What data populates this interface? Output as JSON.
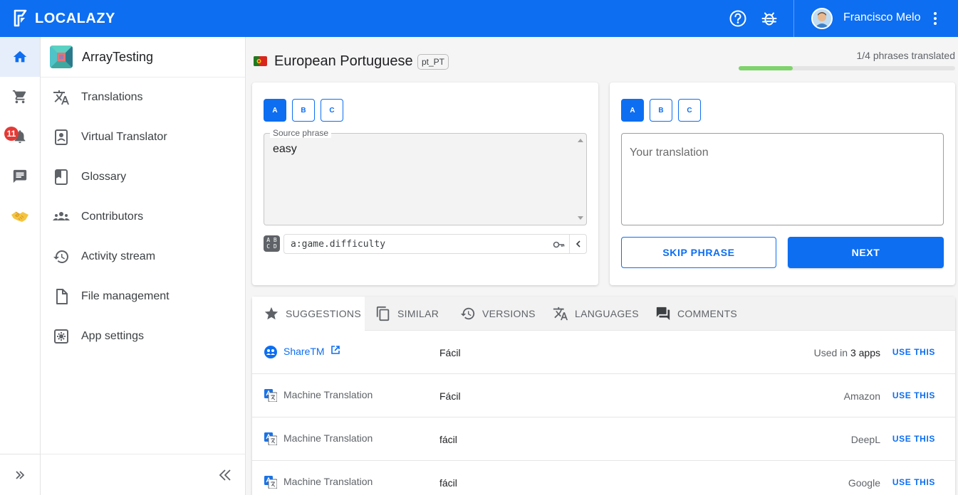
{
  "app": {
    "name": "LOCALAZY"
  },
  "header": {
    "user_name": "Francisco Melo"
  },
  "rail": {
    "notification_count": "11"
  },
  "project": {
    "name": "ArrayTesting",
    "nav": [
      {
        "label": "Translations",
        "icon": "translate-icon"
      },
      {
        "label": "Virtual Translator",
        "icon": "virtual-translator-icon"
      },
      {
        "label": "Glossary",
        "icon": "book-icon"
      },
      {
        "label": "Contributors",
        "icon": "people-icon"
      },
      {
        "label": "Activity stream",
        "icon": "history-icon"
      },
      {
        "label": "File management",
        "icon": "file-icon"
      },
      {
        "label": "App settings",
        "icon": "settings-box-icon"
      }
    ]
  },
  "language": {
    "title": "European Portuguese",
    "code": "pt_PT",
    "progress_text": "1/4 phrases translated",
    "progress_fraction": 0.25
  },
  "source": {
    "plural_forms": [
      "A",
      "B",
      "C"
    ],
    "label": "Source phrase",
    "text": "easy",
    "key_badge": "A B\nC D",
    "key": "a:game.difficulty"
  },
  "translation": {
    "plural_forms": [
      "A",
      "B",
      "C"
    ],
    "placeholder": "Your translation",
    "skip_label": "SKIP PHRASE",
    "next_label": "NEXT"
  },
  "tabs": [
    {
      "label": "SUGGESTIONS",
      "icon": "star-icon",
      "active": true
    },
    {
      "label": "SIMILAR",
      "icon": "copy-icon"
    },
    {
      "label": "VERSIONS",
      "icon": "history-icon"
    },
    {
      "label": "LANGUAGES",
      "icon": "translate-icon"
    },
    {
      "label": "COMMENTS",
      "icon": "comment-icon"
    }
  ],
  "suggestions": [
    {
      "source": "ShareTM",
      "value": "Fácil",
      "provider_prefix": "Used in ",
      "provider_bold": "3 apps",
      "action": "USE THIS"
    },
    {
      "source": "Machine Translation",
      "value": "Fácil",
      "provider_prefix": "Amazon",
      "provider_bold": "",
      "action": "USE THIS"
    },
    {
      "source": "Machine Translation",
      "value": "fácil",
      "provider_prefix": "DeepL",
      "provider_bold": "",
      "action": "USE THIS"
    },
    {
      "source": "Machine Translation",
      "value": "fácil",
      "provider_prefix": "Google",
      "provider_bold": "",
      "action": "USE THIS"
    }
  ],
  "colors": {
    "primary": "#0d6ef1",
    "progress": "#7ed36b",
    "badge": "#e53935"
  }
}
